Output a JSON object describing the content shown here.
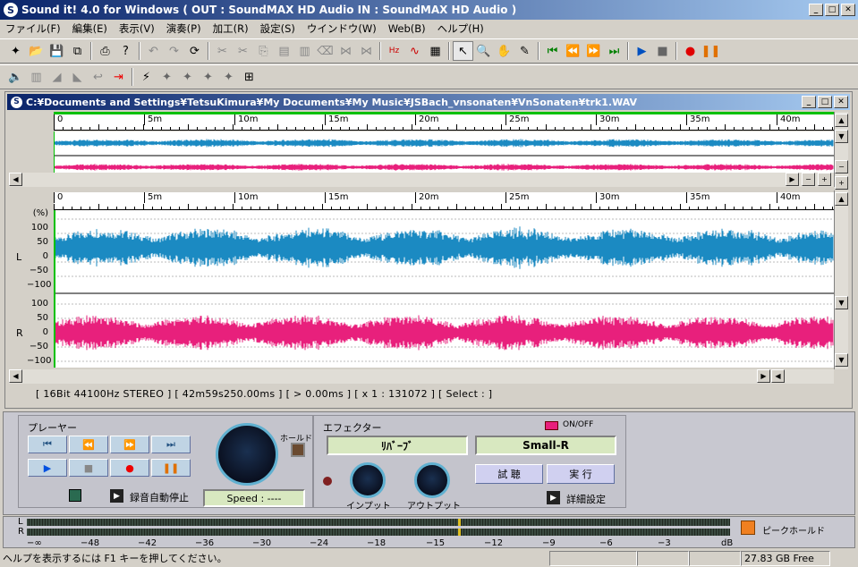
{
  "window": {
    "title": "Sound it! 4.0 for Windows  ( OUT : SoundMAX HD Audio  IN : SoundMAX HD Audio  )"
  },
  "menu": [
    "ファイル(F)",
    "編集(E)",
    "表示(V)",
    "演奏(P)",
    "加工(R)",
    "設定(S)",
    "ウインドウ(W)",
    "Web(B)",
    "ヘルプ(H)"
  ],
  "document": {
    "path": "C:¥Documents and Settings¥TetsuKimura¥My Documents¥My Music¥JSBach_vnsonaten¥VnSonaten¥trk1.WAV"
  },
  "ruler_ticks": [
    "0",
    "5m",
    "10m",
    "15m",
    "20m",
    "25m",
    "30m",
    "35m",
    "40m"
  ],
  "axis": {
    "unit": "(%)",
    "levels": [
      "100",
      "50",
      "0",
      "−50",
      "−100"
    ],
    "channels": [
      "L",
      "R"
    ]
  },
  "colors": {
    "left_channel": "#1b8ac2",
    "right_channel": "#e8207c",
    "cursor": "#00c000"
  },
  "status": {
    "info": "[ 16Bit   44100Hz   STEREO ]  [ 42m59s250.00ms ]  [ > 0.00ms ]  [ x 1 : 131072 ]  [ Select :  ]"
  },
  "player": {
    "title": "プレーヤー",
    "hold_label": "ホールド",
    "auto_stop_label": "録音自動停止",
    "speed_label": "Speed : ----"
  },
  "effector": {
    "title": "エフェクター",
    "onoff_label": "ON/OFF",
    "effect_name": "ﾘﾊﾞｰﾌﾞ",
    "preset_name": "Small-R",
    "preview_label": "試 聴",
    "execute_label": "実 行",
    "input_label": "インプット",
    "output_label": "アウトプット",
    "detail_label": "詳細設定"
  },
  "meter": {
    "channels": [
      "L",
      "R"
    ],
    "scale": [
      "−∞",
      "−48",
      "−42",
      "−36",
      "−30",
      "−24",
      "−18",
      "−15",
      "−12",
      "−9",
      "−6",
      "−3",
      "dB"
    ],
    "peak_hold_label": "ピークホールド"
  },
  "statusbar": {
    "help": "ヘルプを表示するには F1 キーを押してください。",
    "free": "27.83 GB Free"
  }
}
